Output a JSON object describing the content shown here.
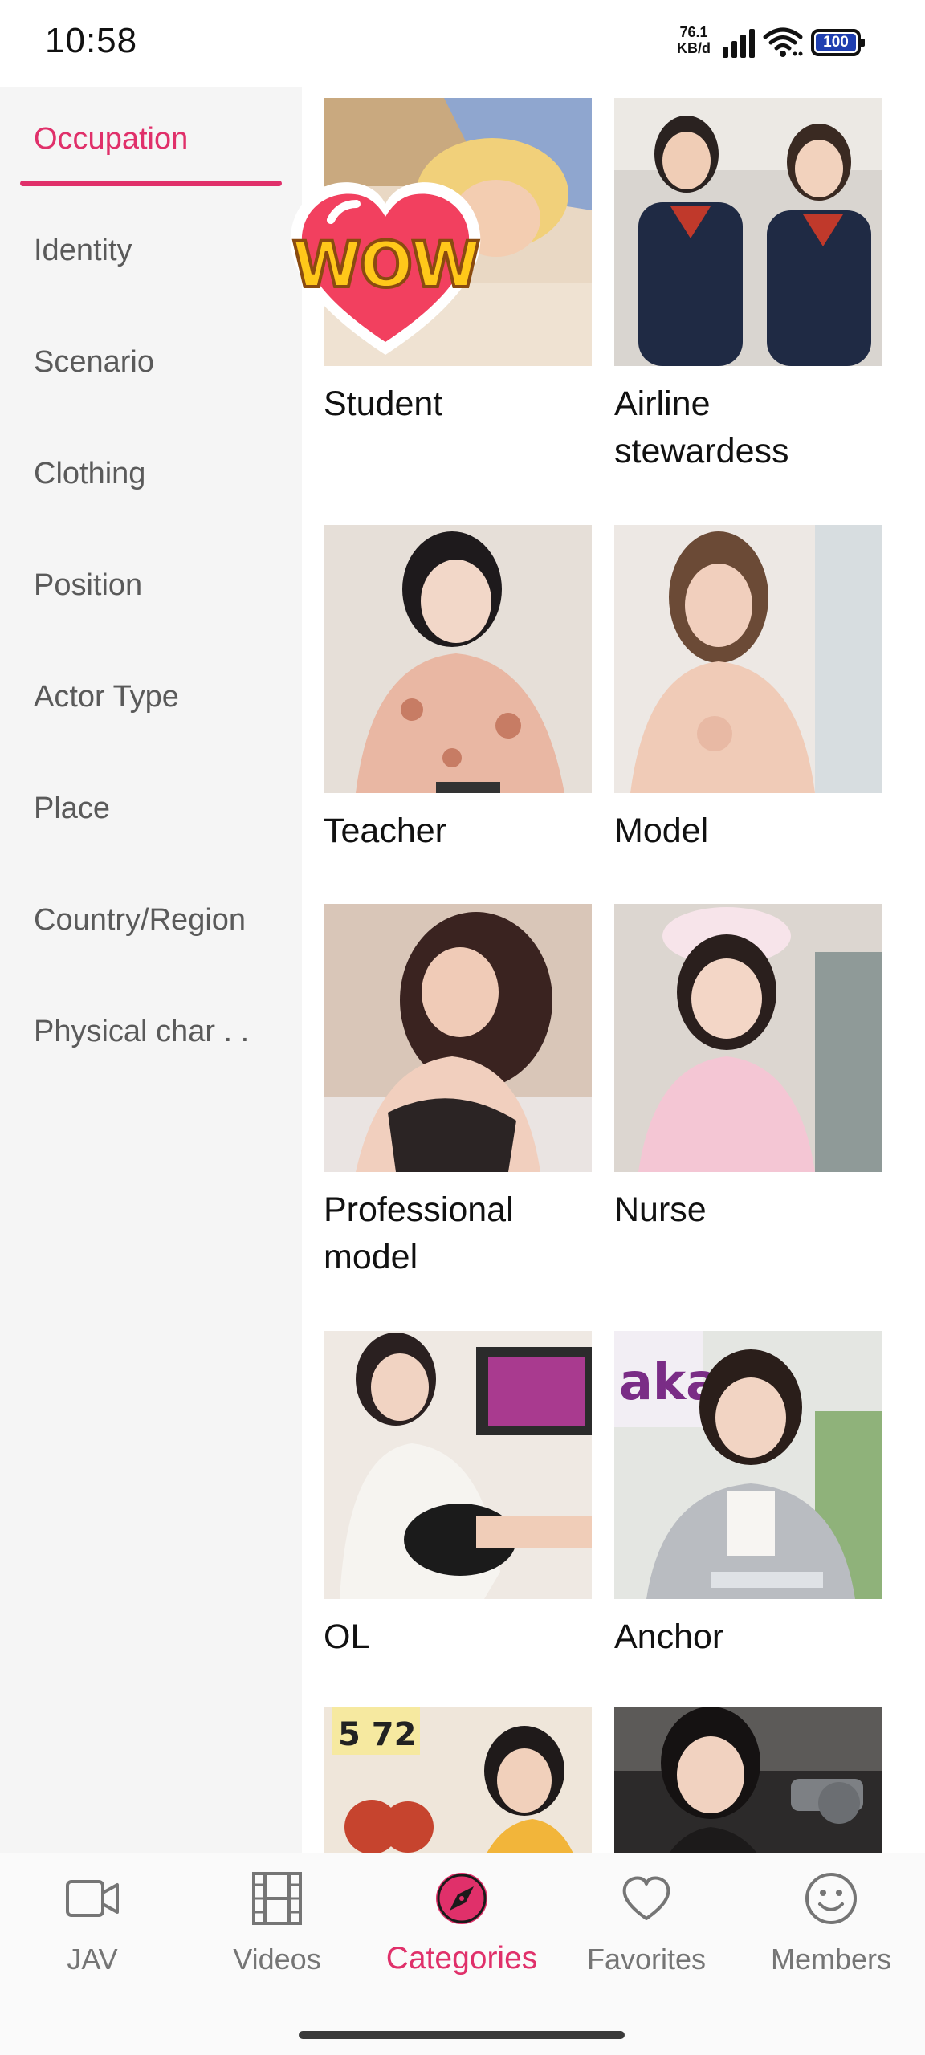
{
  "status_bar": {
    "time": "10:58",
    "network_speed_value": "76.1",
    "network_speed_unit": "KB/d",
    "battery": "100",
    "icons": [
      "signal-icon",
      "wifi-icon",
      "battery-icon"
    ]
  },
  "sidebar": {
    "active_index": 0,
    "accent_color": "#e0306a",
    "items": [
      {
        "label": "Occupation"
      },
      {
        "label": "Identity"
      },
      {
        "label": "Scenario"
      },
      {
        "label": "Clothing"
      },
      {
        "label": "Position"
      },
      {
        "label": "Actor Type"
      },
      {
        "label": "Place"
      },
      {
        "label": "Country/Region"
      },
      {
        "label": "Physical char . ."
      }
    ]
  },
  "grid": {
    "badge": {
      "text": "WOW"
    },
    "cards": [
      {
        "title": "Student"
      },
      {
        "title": "Airline stewardess"
      },
      {
        "title": "Teacher"
      },
      {
        "title": "Model"
      },
      {
        "title": "Professional model"
      },
      {
        "title": "Nurse"
      },
      {
        "title": "OL"
      },
      {
        "title": "Anchor"
      },
      {
        "title": ""
      },
      {
        "title": ""
      }
    ]
  },
  "bottom_nav": {
    "active_index": 2,
    "items": [
      {
        "label": "JAV",
        "icon": "video-camera-icon"
      },
      {
        "label": "Videos",
        "icon": "film-icon"
      },
      {
        "label": "Categories",
        "icon": "compass-icon"
      },
      {
        "label": "Favorites",
        "icon": "heart-icon"
      },
      {
        "label": "Members",
        "icon": "smiley-icon"
      }
    ]
  }
}
